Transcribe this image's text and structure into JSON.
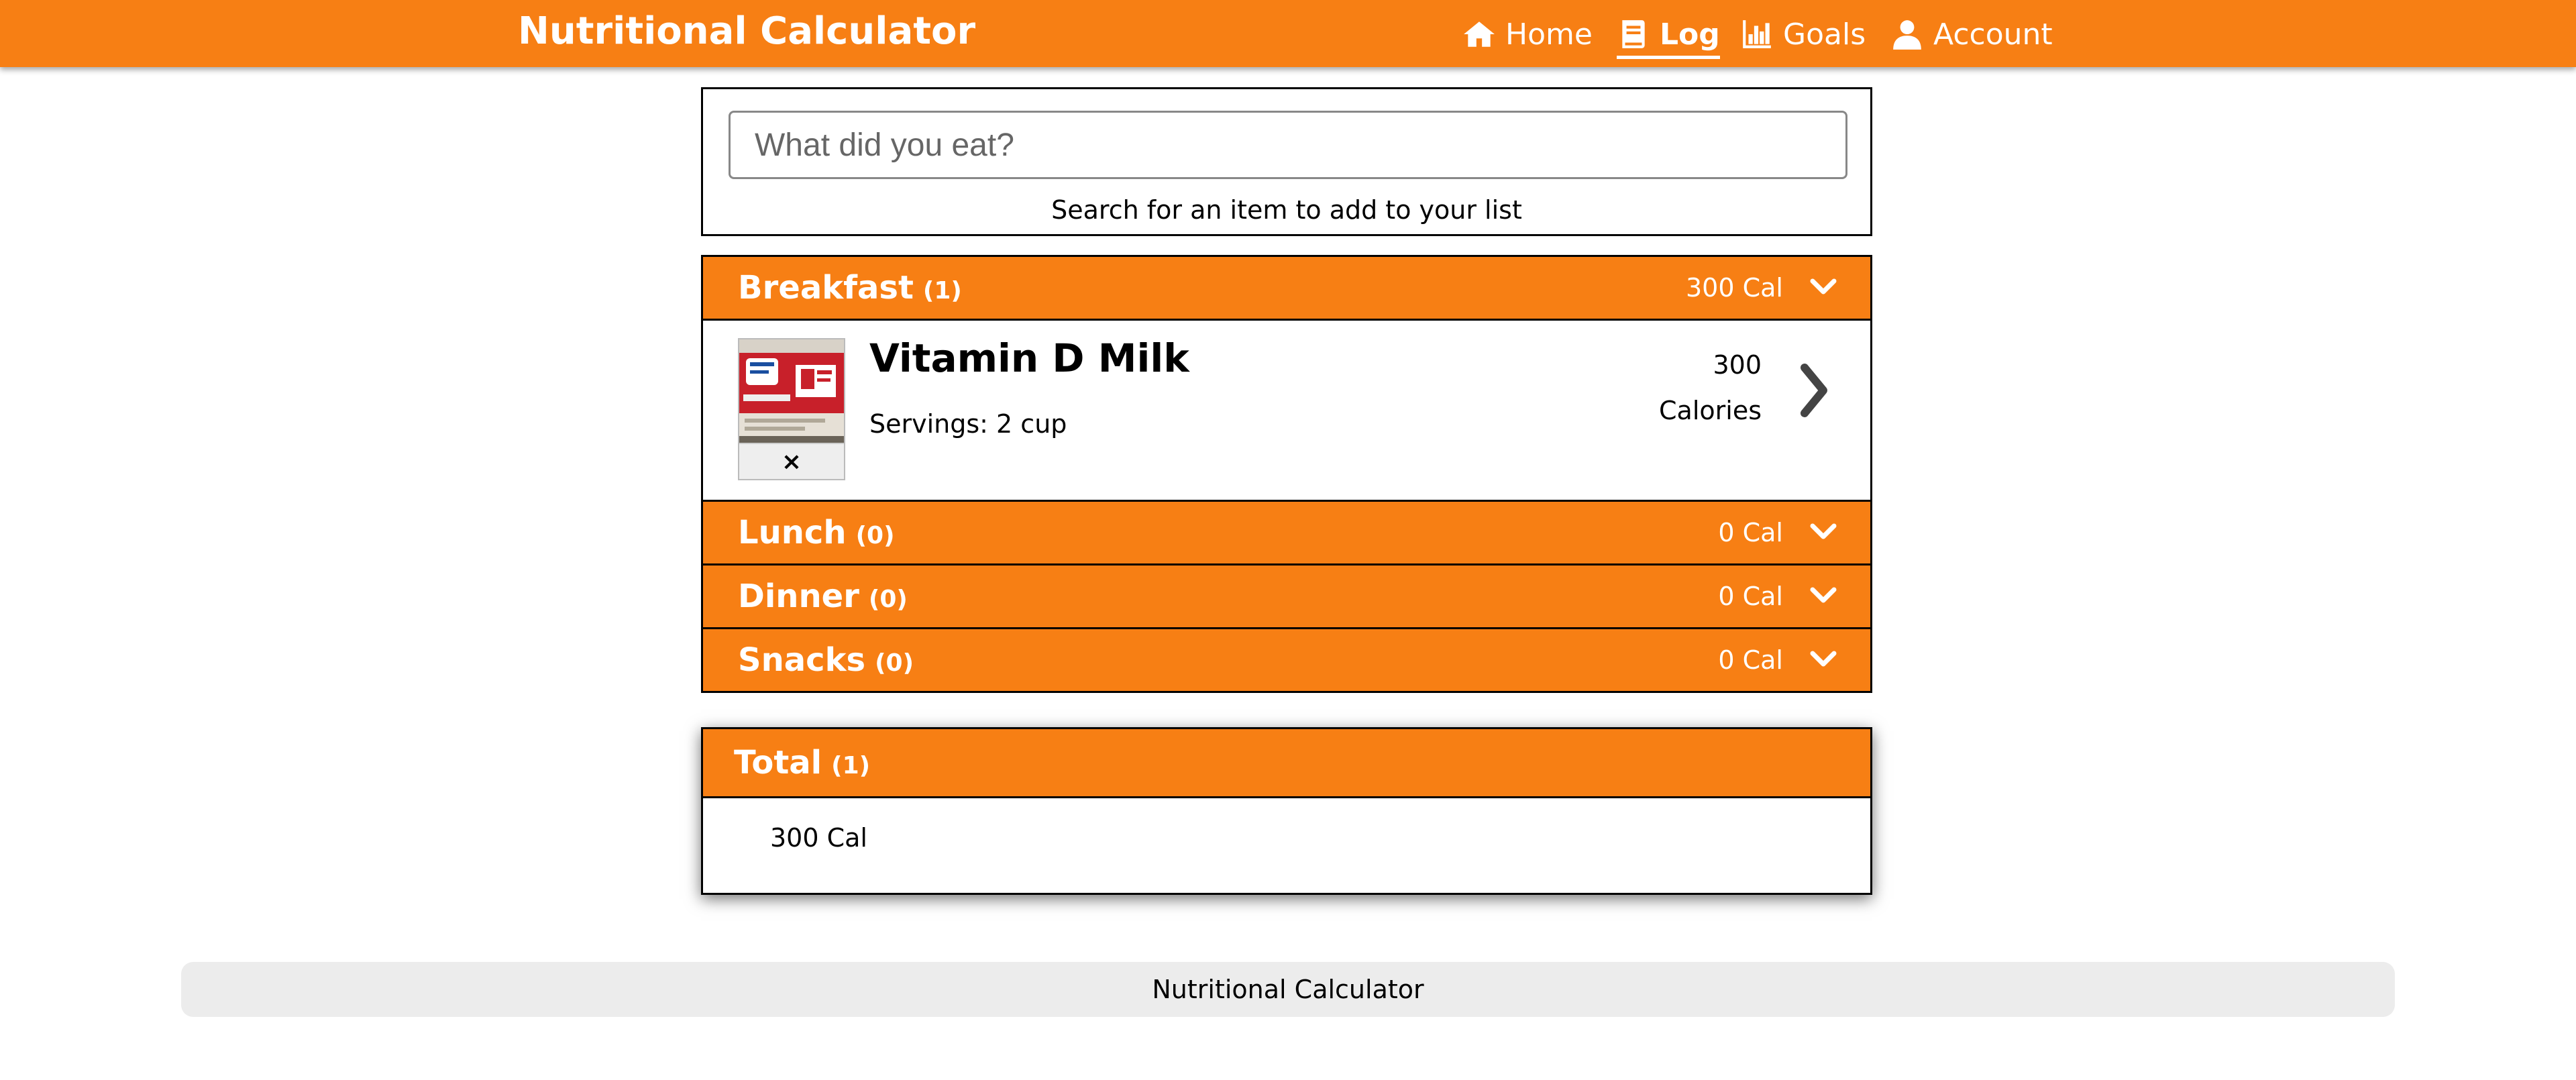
{
  "app": {
    "title": "Nutritional Calculator"
  },
  "nav": {
    "items": [
      {
        "label": "Home",
        "icon": "home-icon",
        "active": false
      },
      {
        "label": "Log",
        "icon": "book-icon",
        "active": true
      },
      {
        "label": "Goals",
        "icon": "bar-chart-icon",
        "active": false
      },
      {
        "label": "Account",
        "icon": "user-icon",
        "active": false
      }
    ]
  },
  "search": {
    "placeholder": "What did you eat?",
    "value": "",
    "help": "Search for an item to add to your list"
  },
  "meals": [
    {
      "name": "Breakfast",
      "count": "(1)",
      "calories": "300 Cal",
      "items": [
        {
          "name": "Vitamin D Milk",
          "servings": "Servings: 2 cup",
          "calories": "300",
          "calories_unit": "Calories",
          "remove": "×"
        }
      ]
    },
    {
      "name": "Lunch",
      "count": "(0)",
      "calories": "0 Cal",
      "items": []
    },
    {
      "name": "Dinner",
      "count": "(0)",
      "calories": "0 Cal",
      "items": []
    },
    {
      "name": "Snacks",
      "count": "(0)",
      "calories": "0 Cal",
      "items": []
    }
  ],
  "total": {
    "title": "Total",
    "count": "(1)",
    "calories": "300 Cal"
  },
  "footer": {
    "text": "Nutritional Calculator"
  },
  "colors": {
    "accent": "#f77f14",
    "border": "#000000",
    "footer_bg": "#ececec"
  }
}
